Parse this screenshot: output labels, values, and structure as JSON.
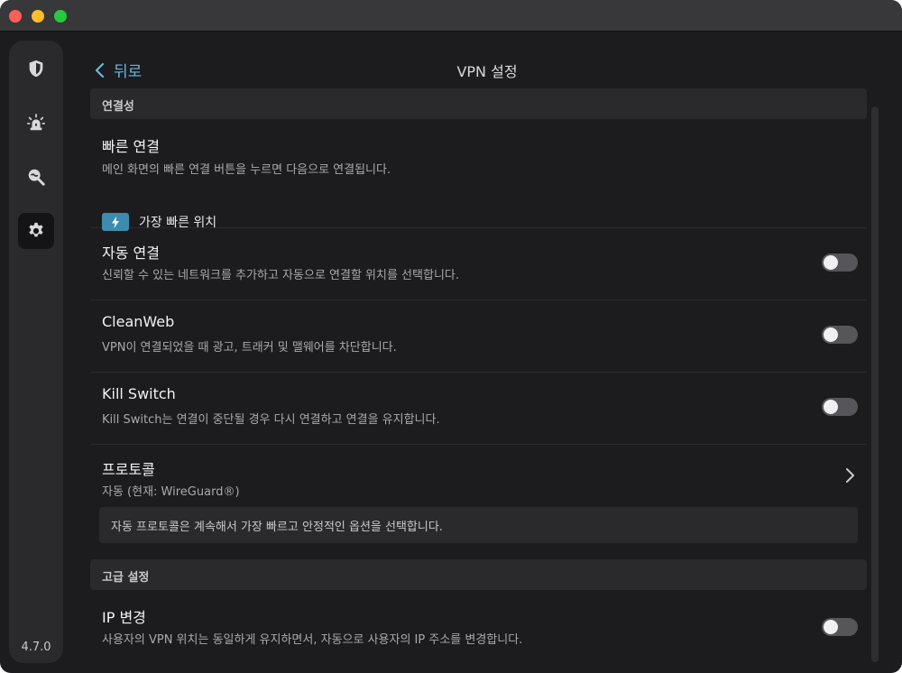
{
  "sidebar": {
    "items": [
      {
        "name": "shield-icon",
        "active": false
      },
      {
        "name": "alarm-icon",
        "active": false
      },
      {
        "name": "search-icon",
        "active": false
      },
      {
        "name": "gear-icon",
        "active": true
      }
    ],
    "version": "4.7.0"
  },
  "header": {
    "back_label": "뒤로",
    "title": "VPN 설정"
  },
  "sections": {
    "connectivity": "연결성",
    "advanced": "고급 설정"
  },
  "quick_connect": {
    "title": "빠른 연결",
    "desc": "메인 화면의 빠른 연결 버튼을 누르면 다음으로 연결됩니다.",
    "option": "가장 빠른 위치"
  },
  "auto_connect": {
    "title": "자동 연결",
    "desc": "신뢰할 수 있는 네트워크를 추가하고 자동으로 연결할 위치를 선택합니다.",
    "enabled": false
  },
  "cleanweb": {
    "title": "CleanWeb",
    "desc": "VPN이 연결되었을 때 광고, 트래커 및 맬웨어를 차단합니다.",
    "enabled": false
  },
  "kill_switch": {
    "title": "Kill Switch",
    "desc": "Kill Switch는 연결이 중단될 경우 다시 연결하고 연결을 유지합니다.",
    "enabled": false
  },
  "protocol": {
    "title": "프로토콜",
    "value": "자동 (현재: WireGuard®)",
    "info": "자동 프로토콜은 계속해서 가장 빠르고 안정적인 옵션을 선택합니다."
  },
  "ip_change": {
    "title": "IP 변경",
    "desc": "사용자의 VPN 위치는 동일하게 유지하면서, 자동으로 사용자의 IP 주소를 변경합니다.",
    "enabled": false
  },
  "colors": {
    "accent": "#6ab8e0",
    "bolt_bg": "#3d8cb0",
    "toggle_off": "#56565a"
  }
}
